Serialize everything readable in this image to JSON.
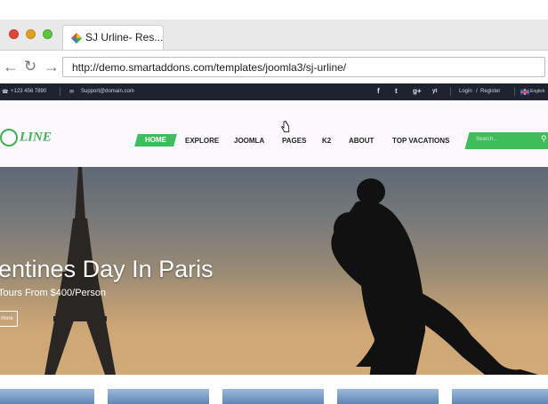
{
  "browser": {
    "tab_title": "SJ Urline- Res...",
    "url": "http://demo.smartaddons.com/templates/joomla3/sj-urline/"
  },
  "topbar": {
    "phone": "+123 456 7890",
    "email": "Support@domain.com",
    "login": "Login",
    "separator": "/",
    "register": "Register",
    "language": "English",
    "social": [
      "f",
      "t",
      "g+",
      "yt"
    ]
  },
  "header": {
    "logo_text": "LINE",
    "nav": [
      "HOME",
      "EXPLORE",
      "JOOMLA",
      "PAGES",
      "K2",
      "ABOUT",
      "TOP VACATIONS"
    ],
    "search_placeholder": "Search..."
  },
  "hero": {
    "title": "entines Day In Paris",
    "subtitle": "Tours From $400/Person",
    "button": "more"
  },
  "colors": {
    "accent": "#3fbd5d",
    "topbar_bg": "#1d2430"
  }
}
